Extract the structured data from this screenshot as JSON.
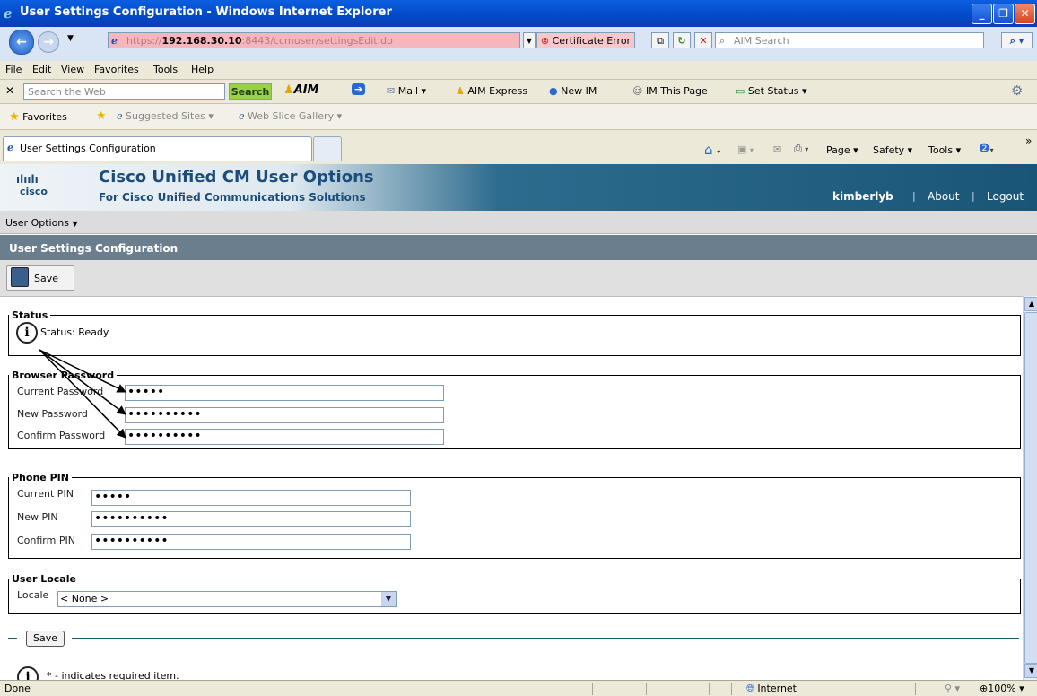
{
  "window": {
    "title": "User Settings Configuration - Windows Internet Explorer"
  },
  "address_bar": {
    "url_prefix": "https://",
    "url_host": "192.168.30.10",
    "url_rest": ":8443/ccmuser/settingsEdit.do",
    "cert_error": "Certificate Error",
    "search_placeholder": "AIM Search"
  },
  "menu": [
    "File",
    "Edit",
    "View",
    "Favorites",
    "Tools",
    "Help"
  ],
  "aim_toolbar": {
    "search_placeholder": "Search the Web",
    "search_button": "Search",
    "aim_label": "AIM",
    "mail": "Mail",
    "aim_express": "AIM Express",
    "new_im": "New IM",
    "im_this_page": "IM This Page",
    "set_status": "Set Status"
  },
  "favorites_bar": {
    "favorites": "Favorites",
    "suggested": "Suggested Sites",
    "slice": "Web Slice Gallery"
  },
  "tab": {
    "label": "User Settings Configuration"
  },
  "command_bar": {
    "page": "Page",
    "safety": "Safety",
    "tools": "Tools"
  },
  "header": {
    "logo_bars": "ılıılı",
    "logo_text": "cisco",
    "product": "Cisco Unified CM User Options",
    "subtitle": "For Cisco Unified Communications Solutions",
    "username": "kimberlyb",
    "about": "About",
    "logout": "Logout"
  },
  "user_options_menu": "User Options",
  "page_title": "User Settings Configuration",
  "toolbar": {
    "save_label": "Save"
  },
  "status": {
    "legend": "Status",
    "text": "Status: Ready"
  },
  "browser_password": {
    "legend": "Browser Password",
    "current_label": "Current Password",
    "current_value": "•••••",
    "new_label": "New Password",
    "new_value": "••••••••••",
    "confirm_label": "Confirm Password",
    "confirm_value": "••••••••••"
  },
  "phone_pin": {
    "legend": "Phone PIN",
    "current_label": "Current PIN",
    "current_value": "•••••",
    "new_label": "New PIN",
    "new_value": "••••••••••",
    "confirm_label": "Confirm PIN",
    "confirm_value": "••••••••••"
  },
  "user_locale": {
    "legend": "User Locale",
    "label": "Locale",
    "selected": "< None >"
  },
  "bottom_save": "Save",
  "footnote": "* - indicates required item.",
  "status_bar": {
    "left": "Done",
    "zone": "Internet",
    "zoom": "100%"
  },
  "colors": {
    "title_bar": "#0348c8",
    "cisco_dark": "#1a5577",
    "page_title_bar": "#6b7e8e",
    "url_error": "#f6b6be"
  }
}
